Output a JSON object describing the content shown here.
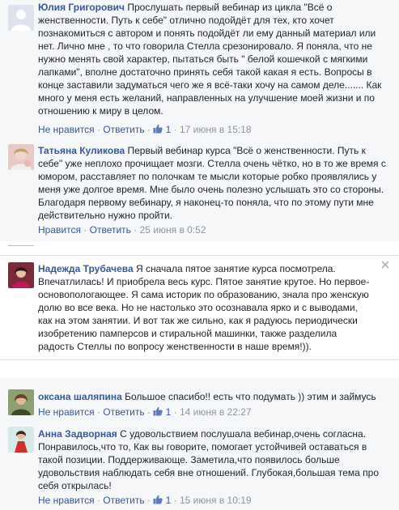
{
  "comments": [
    {
      "author": "Юлия Григорович",
      "text": "Прослушать первый вебинар из цикла \"Всё о женственности. Путь к себе\" отлично подойдёт для тех, кто хочет познакомиться с автором и понять подойдёт ли ему данный материал или нет. Лично мне , то что говорила Стелла срезонировало. Я поняла, что не нужно менять свой характер, пытаться быть \" белой кошечкой с мягкими лапками\", вполне достаточно принять себя такой какая я есть. Вопросы в конце заставили задуматься чего же я всё-таки хочу на самом деле....... Как много у меня есть желаний, направленных на улучшение моей жизни и по отношению к миру в целом.",
      "like_label": "Не нравится",
      "reply_label": "Ответить",
      "likes": "1",
      "time": "17 июня в 15:18",
      "colors": {
        "avatar": "#d9dde3"
      }
    },
    {
      "author": "Татьяна Куликова",
      "text": "Первый вебинар курса \"Всё о женственности. Путь к себе\" уже неплохо прочищает мозги. Стелла очень чётко, но в то же время с юмором, расставляет по полочкам те мысли которые робко проявлялись у меня уже долгое время. Мне было очень полезно услышать это со стороны. Благодаря первому вебинару, я наконец-то поняла, что по этому пути мне действительно нужно пройти.",
      "like_label": "Нравится",
      "reply_label": "Ответить",
      "time": "25 июня в 0:52"
    },
    {
      "author": "Надежда Трубачева",
      "text": "Я сначала пятое занятие курса посмотрела. Впечатлилась! И приобрела весь курс. Пятое занятие крутое. Но первое-основопологающее. Я сама историк по образованию, знала про женскую долю во все века. Но не настолько это осознавала ярко и с выводами, как на этом занятии. И вот так же сильно, как я радуюсь периодически изобретению памперсов и стиральной машинки, также разделила радость Стеллы по вопросу женственности в наше время!))."
    },
    {
      "author": "оксана шаляпина",
      "text": "Большое спасибо!! есть что подумать )) этим и займусь",
      "like_label": "Не нравится",
      "reply_label": "Ответить",
      "likes": "1",
      "time": "14 июня в 22:27"
    },
    {
      "author": "Анна Задворная",
      "text": "С удовольствием послушала вебинар,очень согласна. Понравилось,что то, Как вы говорите, помогает устойчивей оставаться в такой позиции. Поддерживающе. Заметила,что появилось больше удовольствия наблюдать себя вне отношений. Глубокая,большая тема про себя открылась!",
      "like_label": "Не нравится",
      "reply_label": "Ответить",
      "likes": "1",
      "time": "15 июня в 10:19"
    }
  ],
  "dot": "·",
  "colors": {
    "link": "#365899",
    "meta": "#90949c",
    "panel": "#f6f7f9"
  }
}
